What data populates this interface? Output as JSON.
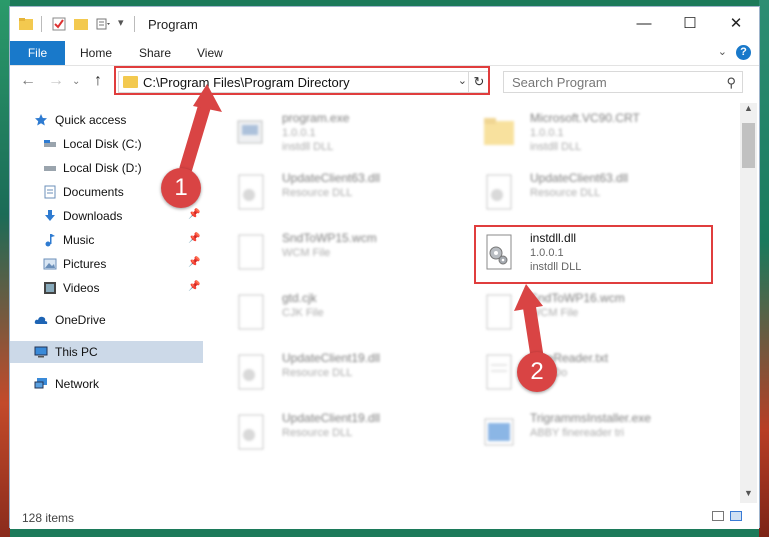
{
  "window": {
    "title": "Program"
  },
  "ribbon": {
    "file": "File",
    "home": "Home",
    "share": "Share",
    "view": "View",
    "help": "?"
  },
  "nav": {
    "address": "C:\\Program Files\\Program Directory",
    "search_placeholder": "Search Program"
  },
  "sidebar": {
    "items": [
      {
        "label": "Quick access",
        "icon": "star-icon"
      },
      {
        "label": "Local Disk (C:)",
        "icon": "drive-icon"
      },
      {
        "label": "Local Disk (D:)",
        "icon": "drive-icon"
      },
      {
        "label": "Documents",
        "icon": "documents-icon"
      },
      {
        "label": "Downloads",
        "icon": "download-icon"
      },
      {
        "label": "Music",
        "icon": "music-icon"
      },
      {
        "label": "Pictures",
        "icon": "pictures-icon"
      },
      {
        "label": "Videos",
        "icon": "videos-icon"
      },
      {
        "label": "OneDrive",
        "icon": "cloud-icon"
      },
      {
        "label": "This PC",
        "icon": "pc-icon"
      },
      {
        "label": "Network",
        "icon": "network-icon"
      }
    ]
  },
  "files": [
    {
      "name": "program.exe",
      "line1": "1.0.0.1",
      "line2": "instdll DLL"
    },
    {
      "name": "Microsoft.VC90.CRT",
      "line1": "1.0.0.1",
      "line2": "instdll DLL"
    },
    {
      "name": "UpdateClient63.dll",
      "line1": "Resource DLL",
      "line2": ""
    },
    {
      "name": "UpdateClient63.dll",
      "line1": "Resource DLL",
      "line2": ""
    },
    {
      "name": "SndToWP15.wcm",
      "line1": "WCM File",
      "line2": ""
    },
    {
      "name": "instdll.dll",
      "line1": "1.0.0.1",
      "line2": "instdll DLL"
    },
    {
      "name": "gtd.cjk",
      "line1": "CJK File",
      "line2": ""
    },
    {
      "name": "SndToWP16.wcm",
      "line1": "WCM File",
      "line2": ""
    },
    {
      "name": "UpdateClient19.dll",
      "line1": "Resource DLL",
      "line2": ""
    },
    {
      "name": "FineReader.txt",
      "line1": "Text Do",
      "line2": ""
    },
    {
      "name": "UpdateClient19.dll",
      "line1": "Resource DLL",
      "line2": ""
    },
    {
      "name": "TrigrammsInstaller.exe",
      "line1": "ABBY finereader tri",
      "line2": ""
    }
  ],
  "status": {
    "items_count": "128 items"
  },
  "annotations": {
    "marker1": "1",
    "marker2": "2"
  },
  "colors": {
    "highlight": "#e03d3d",
    "accent": "#1979ca"
  }
}
